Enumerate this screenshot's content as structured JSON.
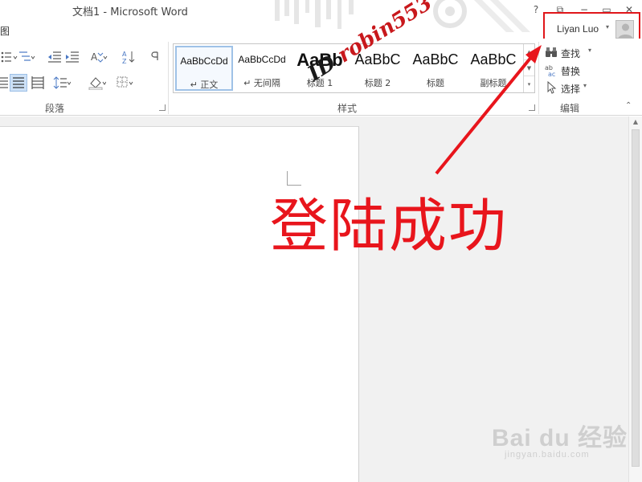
{
  "window": {
    "title": "文档1 - Microsoft Word",
    "help": "?",
    "restore": "⧉",
    "minimize": "−",
    "maximize": "▭",
    "close": "✕"
  },
  "tabs": {
    "view_partial": "图"
  },
  "account": {
    "user_name": "Liyan Luo",
    "caret": "▾"
  },
  "ribbon": {
    "groups": {
      "paragraph": "段落",
      "styles": "样式",
      "editing": "编辑"
    },
    "styles": [
      {
        "sample": "AaBbCcDd",
        "name": "↵ 正文"
      },
      {
        "sample": "AaBbCcDd",
        "name": "↵ 无间隔"
      },
      {
        "sample": "AaBb",
        "name": "标题 1"
      },
      {
        "sample": "AaBbC",
        "name": "标题 2"
      },
      {
        "sample": "AaBbC",
        "name": "标题"
      },
      {
        "sample": "AaBbC",
        "name": "副标题"
      }
    ],
    "editing": {
      "find": "查找",
      "replace": "替换",
      "select": "选择"
    }
  },
  "annotation": {
    "success_text": "登陆成功",
    "watermark_id": "ID ",
    "watermark_name": "robin553",
    "color": "#e8151c"
  },
  "baidu": {
    "logo": "Bai du 经验",
    "url": "jingyan.baidu.com"
  }
}
